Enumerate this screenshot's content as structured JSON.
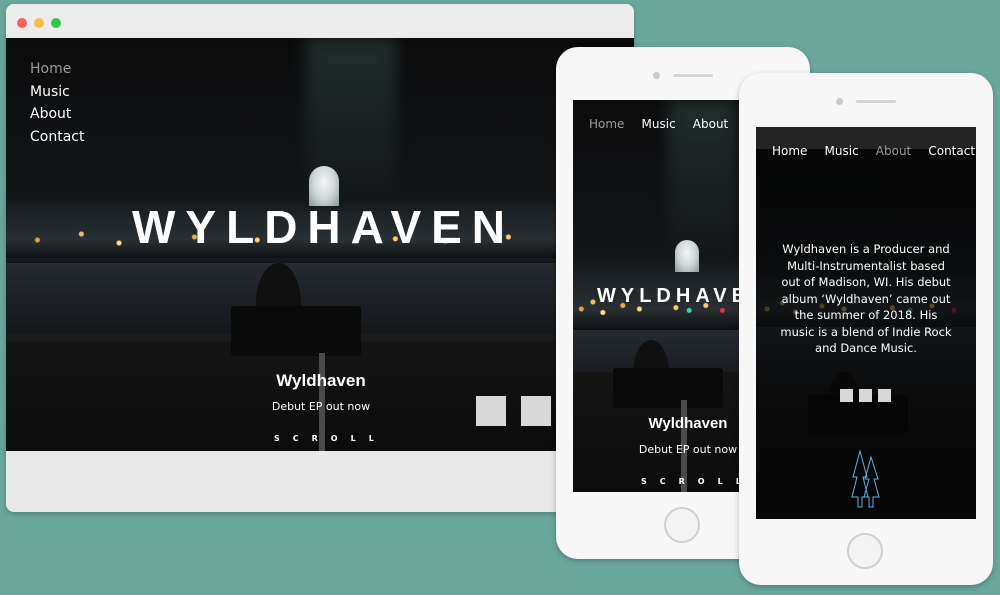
{
  "nav": {
    "items": [
      "Home",
      "Music",
      "About",
      "Contact"
    ]
  },
  "desktop": {
    "title": "WYLDHAVEN",
    "subhead": "Wyldhaven",
    "tagline": "Debut EP out now",
    "scroll": "SCROLL"
  },
  "phone1": {
    "title": "WYLDHAVEN",
    "subhead": "Wyldhaven",
    "tagline": "Debut EP out now",
    "scroll": "SCROLL"
  },
  "phone2": {
    "bio": "Wyldhaven is a Producer and Multi-Instrumentalist based out of Madison, WI. His debut album ‘Wyldhaven’ came out the summer of 2018. His music is a blend of Indie Rock and Dance Music."
  },
  "colors": {
    "background": "#6aa89c",
    "text": "#ffffff",
    "active_nav": "#9a9a9a"
  }
}
